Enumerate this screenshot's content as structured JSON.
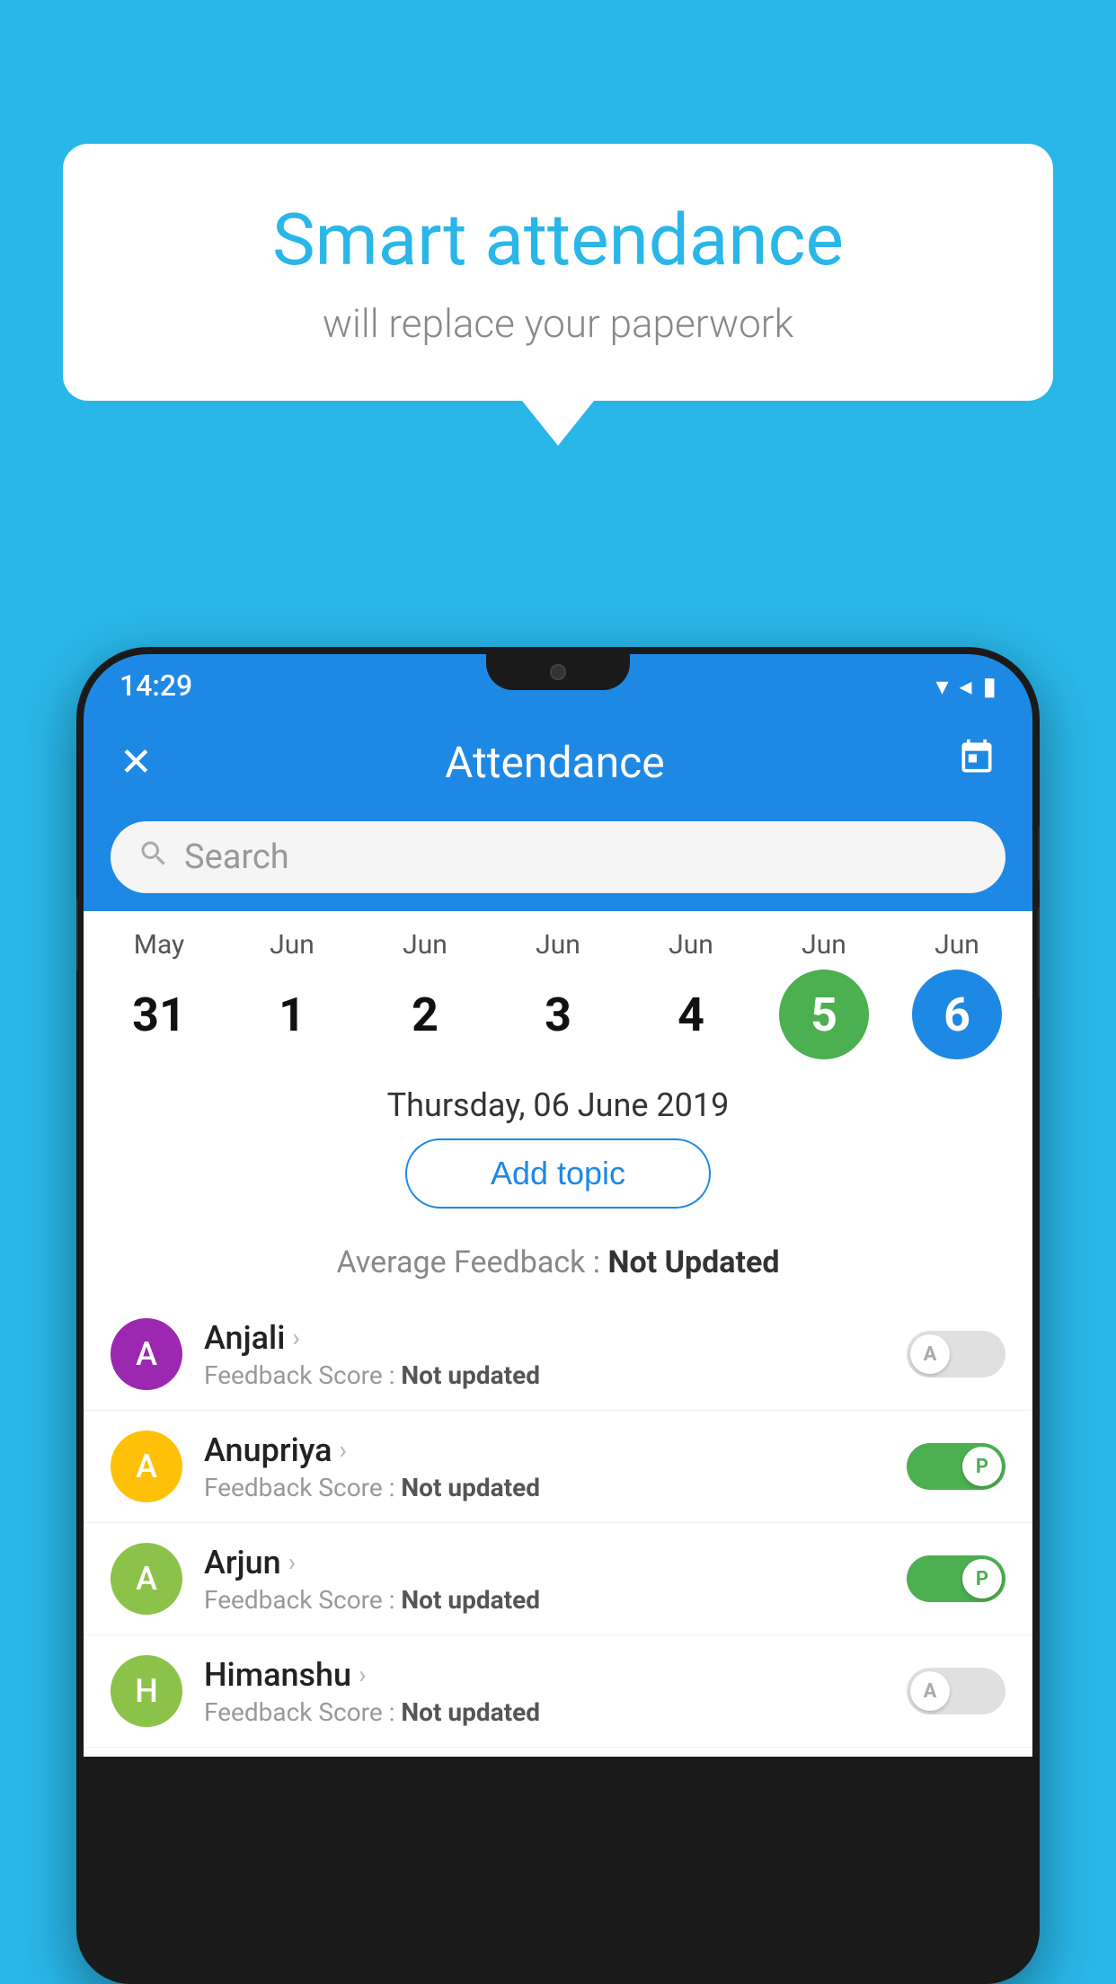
{
  "background_color": "#29B6E8",
  "speech_bubble": {
    "title": "Smart attendance",
    "subtitle": "will replace your paperwork"
  },
  "phone": {
    "status_bar": {
      "time": "14:29",
      "wifi_icon": "▾",
      "signal_icon": "▲",
      "battery_icon": "▮"
    },
    "header": {
      "close_label": "✕",
      "title": "Attendance",
      "calendar_icon": "📅"
    },
    "search": {
      "placeholder": "Search"
    },
    "calendar": {
      "days": [
        {
          "month": "May",
          "date": "31",
          "highlight": ""
        },
        {
          "month": "Jun",
          "date": "1",
          "highlight": ""
        },
        {
          "month": "Jun",
          "date": "2",
          "highlight": ""
        },
        {
          "month": "Jun",
          "date": "3",
          "highlight": ""
        },
        {
          "month": "Jun",
          "date": "4",
          "highlight": ""
        },
        {
          "month": "Jun",
          "date": "5",
          "highlight": "green"
        },
        {
          "month": "Jun",
          "date": "6",
          "highlight": "blue"
        }
      ]
    },
    "selected_date": "Thursday, 06 June 2019",
    "add_topic_label": "Add topic",
    "avg_feedback_label": "Average Feedback : ",
    "avg_feedback_value": "Not Updated",
    "students": [
      {
        "name": "Anjali",
        "avatar_letter": "A",
        "avatar_color": "#9C27B0",
        "feedback_label": "Feedback Score : ",
        "feedback_value": "Not updated",
        "toggle": "off",
        "toggle_label": "A"
      },
      {
        "name": "Anupriya",
        "avatar_letter": "A",
        "avatar_color": "#FFC107",
        "feedback_label": "Feedback Score : ",
        "feedback_value": "Not updated",
        "toggle": "on",
        "toggle_label": "P"
      },
      {
        "name": "Arjun",
        "avatar_letter": "A",
        "avatar_color": "#8BC34A",
        "feedback_label": "Feedback Score : ",
        "feedback_value": "Not updated",
        "toggle": "on",
        "toggle_label": "P"
      },
      {
        "name": "Himanshu",
        "avatar_letter": "H",
        "avatar_color": "#8BC34A",
        "feedback_label": "Feedback Score : ",
        "feedback_value": "Not updated",
        "toggle": "off",
        "toggle_label": "A"
      }
    ]
  }
}
